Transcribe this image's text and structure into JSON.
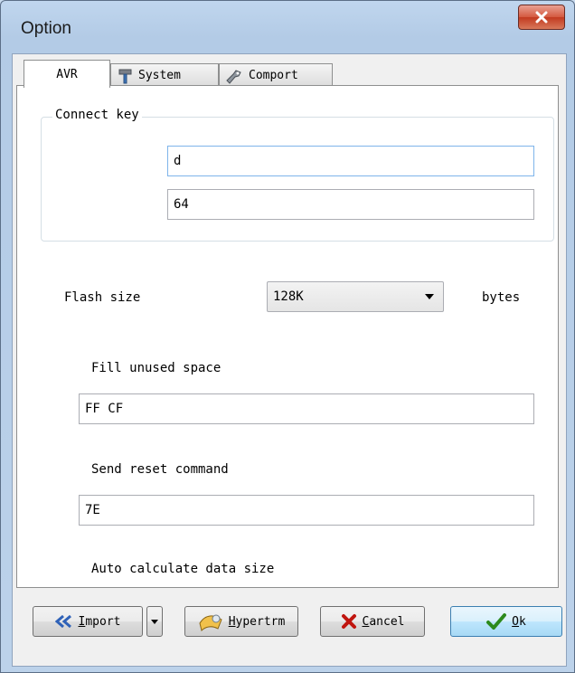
{
  "window": {
    "title": "Option",
    "close_glyph": "X"
  },
  "tabs": [
    {
      "label": "AVR",
      "icon": "none",
      "active": true
    },
    {
      "label": "System",
      "icon": "hammer-icon",
      "active": false
    },
    {
      "label": "Comport",
      "icon": "wrench-icon",
      "active": false
    }
  ],
  "connect_key": {
    "group_label": "Connect key",
    "field1_value": "d",
    "field2_value": "64"
  },
  "flash": {
    "label": "Flash size",
    "selected": "128K",
    "unit": "bytes"
  },
  "fill_unused": {
    "label": "Fill unused space",
    "value": "FF CF"
  },
  "reset": {
    "label": "Send reset command",
    "value": "7E"
  },
  "auto_calc": {
    "label": "Auto calculate data size"
  },
  "buttons": {
    "import": {
      "mnemonic": "I",
      "rest": "mport"
    },
    "hypertrm": {
      "mnemonic": "H",
      "rest": "ypertrm"
    },
    "cancel": {
      "mnemonic": "C",
      "rest": "ancel"
    },
    "ok": {
      "mnemonic": "O",
      "rest": "k"
    }
  },
  "colors": {
    "close": "#c23a20",
    "ok_check": "#2c8a1c",
    "cancel_x": "#c0150f",
    "import_arrow": "#2f62b8"
  }
}
